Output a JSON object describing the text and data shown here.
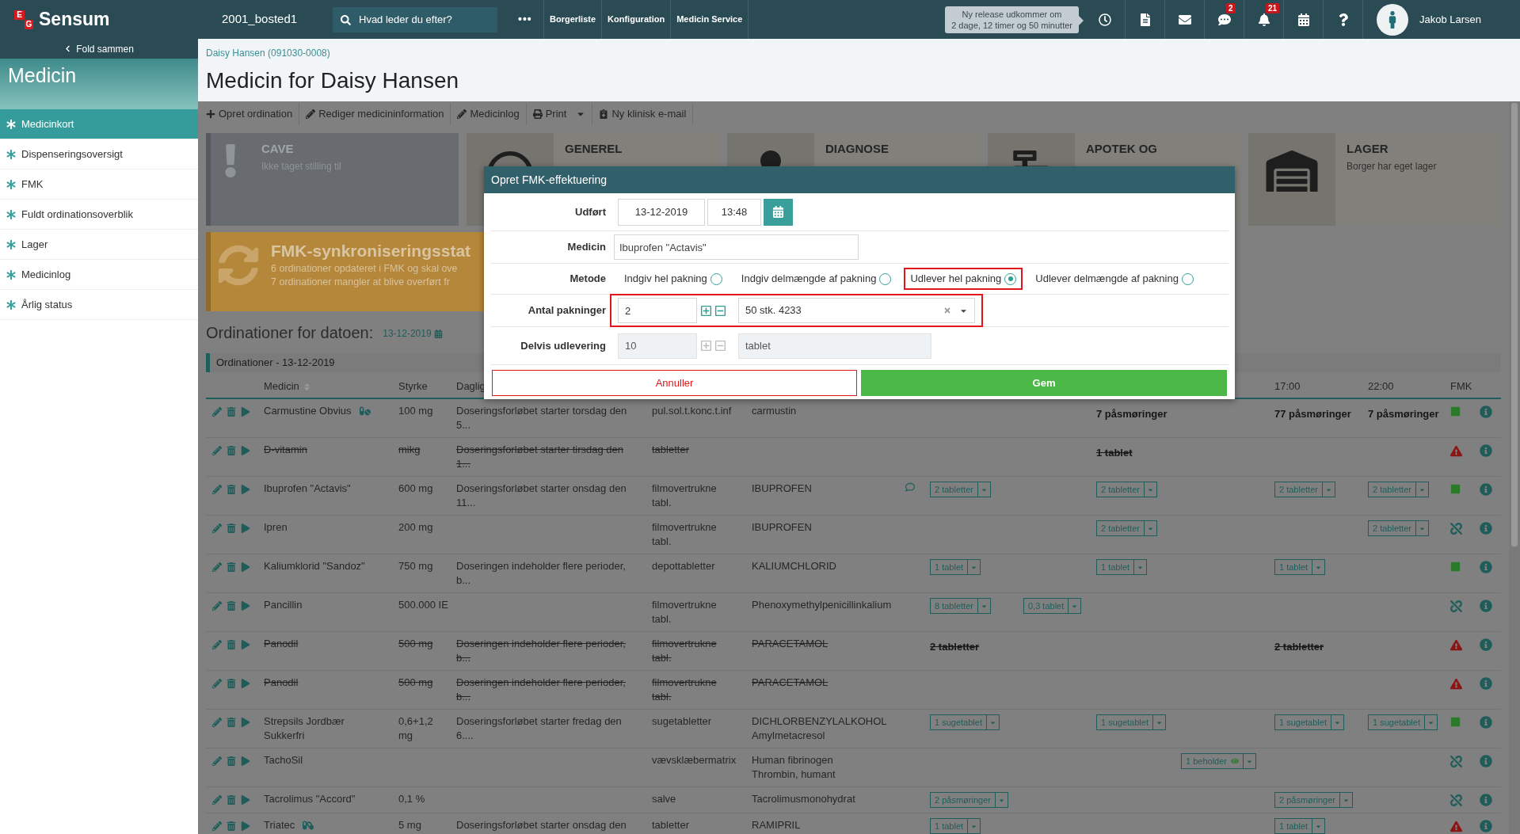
{
  "topbar": {
    "logo_letters": [
      "E",
      "G"
    ],
    "logo_name": "Sensum",
    "location": "2001_bosted1",
    "search": {
      "placeholder": "Hvad leder du efter?"
    },
    "more": "•••",
    "nav": [
      "Borgerliste",
      "Konfiguration",
      "Medicin Service"
    ],
    "release_notice": [
      "Ny release udkommer om",
      "2 dage, 12 timer og 50 minutter"
    ],
    "icons": [
      {
        "kind": "clock"
      },
      {
        "kind": "document"
      },
      {
        "kind": "mail"
      },
      {
        "kind": "chat",
        "badge": "2"
      },
      {
        "kind": "bell",
        "badge": "21"
      },
      {
        "kind": "calendar"
      },
      {
        "kind": "help"
      }
    ],
    "user": "Jakob Larsen"
  },
  "sidebar": {
    "collapse": "Fold sammen",
    "title": "Medicin",
    "items": [
      {
        "label": "Medicinkort",
        "selected": true
      },
      {
        "label": "Dispenseringsoversigt",
        "selected": false
      },
      {
        "label": "FMK",
        "selected": false
      },
      {
        "label": "Fuldt ordinationsoverblik",
        "selected": false
      },
      {
        "label": "Lager",
        "selected": false
      },
      {
        "label": "Medicinlog",
        "selected": false
      },
      {
        "label": "Årlig status",
        "selected": false
      }
    ]
  },
  "breadcrumb": "Daisy Hansen (091030-0008)",
  "page_title": "Medicin for Daisy Hansen",
  "toolbar": [
    {
      "kind": "add",
      "label": "Opret ordination"
    },
    {
      "kind": "edit",
      "label": "Rediger medicininformation"
    },
    {
      "kind": "edit",
      "label": "Medicinlog"
    },
    {
      "kind": "print",
      "label": "Print"
    },
    {
      "kind": "email",
      "label": "Ny klinisk e-mail"
    }
  ],
  "cards": [
    {
      "kind": "cave",
      "title": [
        "CAVE"
      ],
      "text": "Ikke taget stilling til"
    },
    {
      "kind": "instruction",
      "title": [
        "GENEREL"
      ]
    },
    {
      "kind": "diagnosis",
      "title": [
        "DIAGNOSE"
      ]
    },
    {
      "kind": "pharmacy",
      "title": [
        "APOTEK OG"
      ]
    },
    {
      "kind": "storage",
      "title": [
        "LAGER"
      ],
      "text": "Borger har eget lager"
    }
  ],
  "sync_banner": {
    "title": "FMK-synkroniseringsstat",
    "lines": [
      "6 ordinationer opdateret i FMK og skal ove",
      "7 ordinationer mangler at blive overført fr"
    ]
  },
  "date_heading": {
    "label": "Ordinationer for datoen:",
    "date": "13-12-2019"
  },
  "panel_title": "Ordinationer - 13-12-2019",
  "table": {
    "columns": [
      {
        "label": "Medicin",
        "sortable": true
      },
      {
        "label": "Styrke",
        "sortable": false
      },
      {
        "label": "Daglig"
      }
    ],
    "time_headers": {
      "column_11": "17:00",
      "column_12": "22:00"
    },
    "fmk_header": "FMK",
    "rows": [
      {
        "name": "Carmustine Obvius",
        "marker": {
          "kind": "pills"
        },
        "strength": "100 mg",
        "daily": "Doseringsforløbet starter torsdag den 5...",
        "form": "pul.sol.t.konc.t.inf",
        "substances": [
          "carmustin"
        ],
        "comment": false,
        "cancelled": false,
        "fmk": {
          "kind": "synced"
        },
        "doses": {
          "column_9": {
            "kind": "bold",
            "text": "7 påsmøringer"
          },
          "column_11": {
            "kind": "bold",
            "text": "77 påsmøringer"
          },
          "column_12": {
            "kind": "bold",
            "text": "7 påsmøringer"
          }
        }
      },
      {
        "name": "D-vitamin",
        "strength": "mikg",
        "daily": "Doseringsforløbet starter tirsdag den 1...",
        "form": "tabletter",
        "comment": false,
        "cancelled": true,
        "fmk": {
          "kind": "warning"
        },
        "doses": {
          "column_9": {
            "kind": "bold",
            "text": "1 tablet"
          }
        }
      },
      {
        "name": "Ibuprofen \"Actavis\"",
        "strength": "600 mg",
        "daily": "Doseringsforløbet starter onsdag den 11...",
        "form": "filmovertrukne tabl.",
        "substances": [
          "IBUPROFEN"
        ],
        "comment": true,
        "cancelled": false,
        "fmk": {
          "kind": "synced"
        },
        "doses": {
          "column_7": {
            "kind": "dropdown",
            "text": "2 tabletter"
          },
          "column_9": {
            "kind": "dropdown",
            "text": "2 tabletter"
          },
          "column_11": {
            "kind": "dropdown",
            "text": "2 tabletter"
          },
          "column_12": {
            "kind": "dropdown",
            "text": "2 tabletter"
          }
        }
      },
      {
        "name": "Ipren",
        "strength": "200 mg",
        "form": "filmovertrukne tabl.",
        "substances": [
          "IBUPROFEN"
        ],
        "comment": false,
        "cancelled": false,
        "fmk": {
          "kind": "unlinked"
        },
        "doses": {
          "column_9": {
            "kind": "dropdown",
            "text": "2 tabletter"
          },
          "column_12": {
            "kind": "dropdown",
            "text": "2 tabletter"
          }
        }
      },
      {
        "name": "Kaliumklorid \"Sandoz\"",
        "strength": "750 mg",
        "daily": "Doseringen indeholder flere perioder, b...",
        "form": "depottabletter",
        "substances": [
          "KALIUMCHLORID"
        ],
        "comment": false,
        "cancelled": false,
        "fmk": {
          "kind": "synced"
        },
        "doses": {
          "column_7": {
            "kind": "dropdown",
            "text": "1 tablet"
          },
          "column_9": {
            "kind": "dropdown",
            "text": "1 tablet"
          },
          "column_11": {
            "kind": "dropdown",
            "text": "1 tablet"
          }
        }
      },
      {
        "name": "Pancillin",
        "strength": "500.000 IE",
        "form": "filmovertrukne tabl.",
        "substances": [
          "Phenoxymethylpenicillinkalium"
        ],
        "comment": false,
        "cancelled": false,
        "fmk": {
          "kind": "unlinked"
        },
        "doses": {
          "column_7": {
            "kind": "dropdown",
            "text": "8 tabletter"
          },
          "column_8": {
            "kind": "dropdown",
            "text": "0,3 tablet"
          }
        }
      },
      {
        "name": "Panodil",
        "strength": "500 mg",
        "daily": "Doseringen indeholder flere perioder, b...",
        "form": "filmovertrukne tabl.",
        "substances": [
          "PARACETAMOL"
        ],
        "comment": false,
        "cancelled": true,
        "fmk": {
          "kind": "warning"
        },
        "doses": {
          "column_7": {
            "kind": "bold",
            "text": "2 tabletter"
          },
          "column_11": {
            "kind": "bold",
            "text": "2 tabletter"
          }
        }
      },
      {
        "name": "Panodil",
        "strength": "500 mg",
        "daily": "Doseringen indeholder flere perioder, b...",
        "form": "filmovertrukne tabl.",
        "substances": [
          "PARACETAMOL"
        ],
        "comment": false,
        "cancelled": true,
        "fmk": {
          "kind": "warning"
        }
      },
      {
        "name": "Strepsils Jordbær Sukkerfri",
        "strength": "0,6+1,2 mg",
        "daily": "Doseringsforløbet starter fredag den 6....",
        "form": "sugetabletter",
        "substances": [
          "DICHLORBENZYLALKOHOL",
          "Amylmetacresol"
        ],
        "comment": false,
        "cancelled": false,
        "fmk": {
          "kind": "synced"
        },
        "doses": {
          "column_7": {
            "kind": "dropdown",
            "text": "1 sugetablet"
          },
          "column_9": {
            "kind": "dropdown",
            "text": "1 sugetablet"
          },
          "column_11": {
            "kind": "dropdown",
            "text": "1 sugetablet"
          },
          "column_12": {
            "kind": "dropdown",
            "text": "1 sugetablet"
          }
        }
      },
      {
        "name": "TachoSil",
        "form": "vævsklæbermatrix",
        "substances": [
          "Human fibrinogen",
          "Thrombin, humant"
        ],
        "comment": false,
        "cancelled": false,
        "fmk": {
          "kind": "unlinked"
        },
        "doses": {
          "column_10": {
            "kind": "dropdown",
            "text": "1 beholder",
            "eye": true
          }
        }
      },
      {
        "name": "Tacrolimus \"Accord\"",
        "strength": "0,1 %",
        "form": "salve",
        "substances": [
          "Tacrolimusmonohydrat"
        ],
        "comment": false,
        "cancelled": false,
        "fmk": {
          "kind": "unlinked"
        },
        "doses": {
          "column_7": {
            "kind": "dropdown",
            "text": "2 påsmøringer"
          },
          "column_11": {
            "kind": "dropdown",
            "text": "2 påsmøringer"
          }
        }
      },
      {
        "name": "Triatec",
        "marker": {
          "kind": "capsules"
        },
        "strength": "5 mg",
        "daily": "Doseringsforløbet starter onsdag den",
        "form": "tabletter",
        "substances": [
          "RAMIPRIL"
        ],
        "comment": false,
        "cancelled": false,
        "fmk": {
          "kind": "warning"
        },
        "doses": {
          "column_7": {
            "kind": "dropdown",
            "text": "1 tablet"
          },
          "column_11": {
            "kind": "dropdown",
            "text": "1 tablet"
          }
        }
      }
    ]
  },
  "modal": {
    "title": "Opret FMK-effektuering",
    "performed": {
      "label": "Udført",
      "date": "13-12-2019",
      "time": "13:48"
    },
    "medicine": {
      "label": "Medicin",
      "value": "Ibuprofen \"Actavis\""
    },
    "method": {
      "label": "Metode",
      "options": [
        {
          "label": "Indgiv hel pakning",
          "selected": false,
          "highlighted": false
        },
        {
          "label": "Indgiv delmængde af pakning",
          "selected": false,
          "highlighted": false
        },
        {
          "label": "Udlever hel pakning",
          "selected": true,
          "highlighted": true
        },
        {
          "label": "Udlever delmængde af pakning",
          "selected": false,
          "highlighted": false
        }
      ]
    },
    "packages": {
      "label": "Antal pakninger",
      "value": "2",
      "package": "50 stk. 4233",
      "highlighted": true,
      "disabled": false
    },
    "partial": {
      "label": "Delvis udlevering",
      "value": "10",
      "unit": "tablet",
      "disabled": true
    },
    "cancel": "Annuller",
    "save": "Gem"
  }
}
